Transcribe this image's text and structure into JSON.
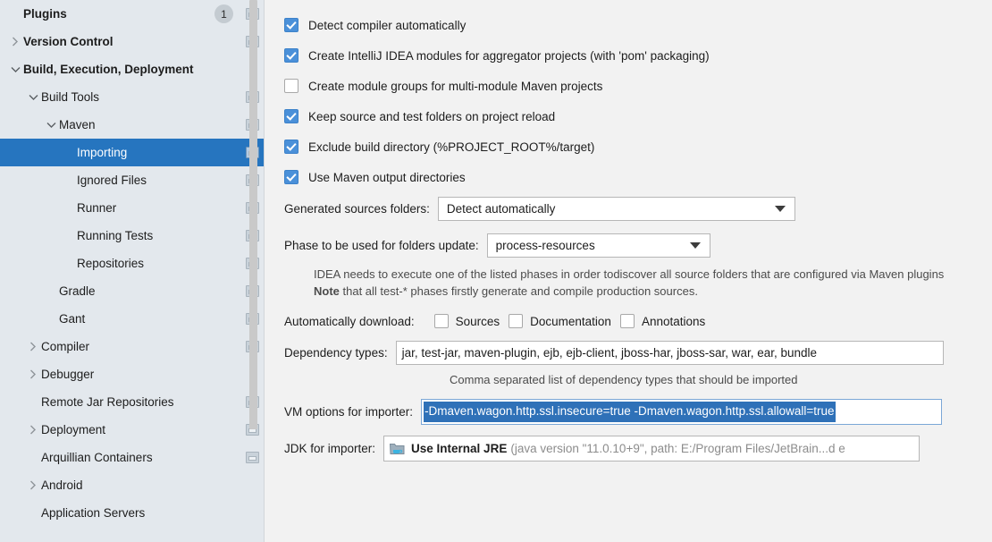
{
  "sidebar": {
    "items": [
      {
        "label": "Plugins",
        "indent": 0,
        "twisty": "none",
        "bold": true,
        "badge": "1",
        "icon": true,
        "selected": false
      },
      {
        "label": "Version Control",
        "indent": 0,
        "twisty": "collapsed",
        "bold": true,
        "badge": null,
        "icon": true,
        "selected": false
      },
      {
        "label": "Build, Execution, Deployment",
        "indent": 0,
        "twisty": "expanded",
        "bold": true,
        "badge": null,
        "icon": false,
        "selected": false
      },
      {
        "label": "Build Tools",
        "indent": 1,
        "twisty": "expanded",
        "bold": false,
        "badge": null,
        "icon": true,
        "selected": false
      },
      {
        "label": "Maven",
        "indent": 2,
        "twisty": "expanded",
        "bold": false,
        "badge": null,
        "icon": true,
        "selected": false
      },
      {
        "label": "Importing",
        "indent": 3,
        "twisty": "none",
        "bold": false,
        "badge": null,
        "icon": true,
        "selected": true
      },
      {
        "label": "Ignored Files",
        "indent": 3,
        "twisty": "none",
        "bold": false,
        "badge": null,
        "icon": true,
        "selected": false
      },
      {
        "label": "Runner",
        "indent": 3,
        "twisty": "none",
        "bold": false,
        "badge": null,
        "icon": true,
        "selected": false
      },
      {
        "label": "Running Tests",
        "indent": 3,
        "twisty": "none",
        "bold": false,
        "badge": null,
        "icon": true,
        "selected": false
      },
      {
        "label": "Repositories",
        "indent": 3,
        "twisty": "none",
        "bold": false,
        "badge": null,
        "icon": true,
        "selected": false
      },
      {
        "label": "Gradle",
        "indent": 2,
        "twisty": "none",
        "bold": false,
        "badge": null,
        "icon": true,
        "selected": false
      },
      {
        "label": "Gant",
        "indent": 2,
        "twisty": "none",
        "bold": false,
        "badge": null,
        "icon": true,
        "selected": false
      },
      {
        "label": "Compiler",
        "indent": 1,
        "twisty": "collapsed",
        "bold": false,
        "badge": null,
        "icon": true,
        "selected": false
      },
      {
        "label": "Debugger",
        "indent": 1,
        "twisty": "collapsed",
        "bold": false,
        "badge": null,
        "icon": false,
        "selected": false
      },
      {
        "label": "Remote Jar Repositories",
        "indent": 1,
        "twisty": "none",
        "bold": false,
        "badge": null,
        "icon": true,
        "selected": false
      },
      {
        "label": "Deployment",
        "indent": 1,
        "twisty": "collapsed",
        "bold": false,
        "badge": null,
        "icon": true,
        "selected": false
      },
      {
        "label": "Arquillian Containers",
        "indent": 1,
        "twisty": "none",
        "bold": false,
        "badge": null,
        "icon": true,
        "selected": false
      },
      {
        "label": "Android",
        "indent": 1,
        "twisty": "collapsed",
        "bold": false,
        "badge": null,
        "icon": false,
        "selected": false
      },
      {
        "label": "Application Servers",
        "indent": 1,
        "twisty": "none",
        "bold": false,
        "badge": null,
        "icon": false,
        "selected": false
      }
    ]
  },
  "main": {
    "checkboxes": [
      {
        "label": "Detect compiler automatically",
        "checked": true
      },
      {
        "label": "Create IntelliJ IDEA modules for aggregator projects (with 'pom' packaging)",
        "checked": true
      },
      {
        "label": "Create module groups for multi-module Maven projects",
        "checked": false
      },
      {
        "label": "Keep source and test folders on project reload",
        "checked": true
      },
      {
        "label": "Exclude build directory (%PROJECT_ROOT%/target)",
        "checked": true
      },
      {
        "label": "Use Maven output directories",
        "checked": true
      }
    ],
    "generated_sources": {
      "label": "Generated sources folders:",
      "value": "Detect automatically"
    },
    "phase_update": {
      "label": "Phase to be used for folders update:",
      "value": "process-resources"
    },
    "note": {
      "line1": "IDEA needs to execute one of the listed phases in order todiscover all source folders that are configured via Maven plugins",
      "line2_bold": "Note",
      "line2_rest": " that all test-* phases firstly generate and compile production sources."
    },
    "auto_download": {
      "label": "Automatically download:",
      "options": [
        {
          "label": "Sources",
          "checked": false
        },
        {
          "label": "Documentation",
          "checked": false
        },
        {
          "label": "Annotations",
          "checked": false
        }
      ]
    },
    "dependency_types": {
      "label": "Dependency types:",
      "value": "jar, test-jar, maven-plugin, ejb, ejb-client, jboss-har, jboss-sar, war, ear, bundle",
      "hint": "Comma separated list of dependency types that should be imported"
    },
    "vm_options": {
      "label": "VM options for importer:",
      "value": "-Dmaven.wagon.http.ssl.insecure=true -Dmaven.wagon.http.ssl.allowall=true"
    },
    "jdk_importer": {
      "label": "JDK for importer:",
      "value_name": "Use Internal JRE",
      "value_path": "(java version \"11.0.10+9\", path: E:/Program Files/JetBrain...d e"
    }
  },
  "colors": {
    "selection_blue": "#2675bf",
    "checkbox_blue": "#4a90d9",
    "text_selection_blue": "#2f71b8",
    "sidebar_bg": "#e3e8ed",
    "main_bg": "#f2f2f2"
  }
}
